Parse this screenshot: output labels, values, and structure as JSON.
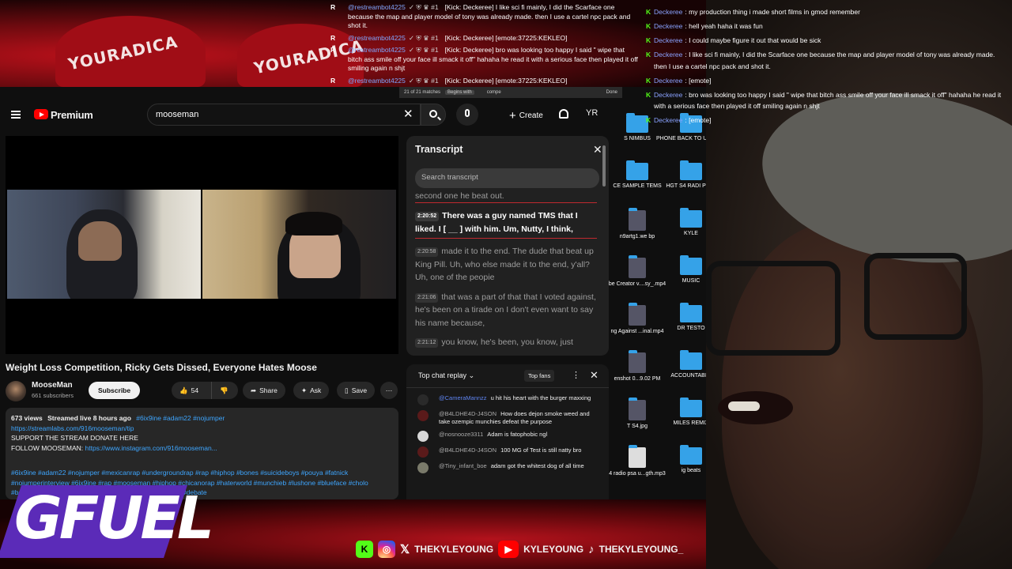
{
  "top_chat": [
    {
      "platform": "R",
      "user": "@restreambot4225",
      "badges": "✓ ⛨ ♛ #1",
      "text": "[Kick: Deckeree] I like sci fi mainly, I did the Scarface one because the map and player model of tony was already made. then I use a cartel npc pack and shot it."
    },
    {
      "platform": "R",
      "user": "@restreambot4225",
      "badges": "✓ ⛨ ♛ #1",
      "text": "[Kick: Deckeree] [emote:37225:KEKLEO]"
    },
    {
      "platform": "R",
      "user": "@restreambot4225",
      "badges": "✓ ⛨ ♛ #1",
      "text": "[Kick: Deckeree] bro was looking too happy I said \" wipe that bitch ass smile off your face ill smack it off\" hahaha he read it with a serious face then played it off smiling again n shjt"
    },
    {
      "platform": "R",
      "user": "@restreambot4225",
      "badges": "✓ ⛨ ♛ #1",
      "text": "[Kick: Deckeree] [emote:37225:KEKLEO]"
    }
  ],
  "find_bar": {
    "count": "21 of 21 matches",
    "mode": "Begins with",
    "query": "compe",
    "done": "Done"
  },
  "header": {
    "brand": "Premium",
    "search_value": "mooseman",
    "create_label": "Create",
    "avatar_initials": "YR"
  },
  "video": {
    "title": "Weight Loss Competition, Ricky Gets Dissed, Everyone Hates Moose",
    "channel": "MooseMan",
    "subscribers": "661 subscribers",
    "subscribe_label": "Subscribe",
    "likes": "54",
    "share_label": "Share",
    "ask_label": "Ask",
    "save_label": "Save"
  },
  "description": {
    "views": "673 views",
    "streamed": "Streamed live 8 hours ago",
    "hashtags_top": "#6ix9ine #adam22 #nojumper",
    "link1": "https://streamlabs.com/916mooseman/tip",
    "line2": "SUPPORT THE STREAM DONATE HERE",
    "follow_prefix": "FOLLOW MOOSEMAN:",
    "link2": "https://www.instagram.com/916mooseman...",
    "tags": "#6ix9ine #adam22 #nojumper #mexicanrap #undergroundrap #rap #hiphop #bones #suicideboys #pouya #fatnick #nojumperinterview #6ix9ine #rap #mooseman #hiphop #chicanorap #haterworld #munchieb #lushone #blueface #cholo #bomberboy #chicanorap #chicano #racedebate #hiphop #debate"
  },
  "transcript": {
    "title": "Transcript",
    "search_placeholder": "Search transcript",
    "partial": "second one he beat out.",
    "segments": [
      {
        "time": "2:20:52",
        "text": "There was a guy named TMS that I liked. I [ __ ] with him. Um, Nutty, I think,",
        "active": true
      },
      {
        "time": "2:20:58",
        "text": "made it to the end. The dude that beat up King Pill. Uh, who else made it to the end, y'all? Uh, one of the peopie",
        "active": false
      },
      {
        "time": "2:21:06",
        "text": "that was a part of that that I voted against, he's been on a tirade on I don't even want to say his name because,",
        "active": false
      },
      {
        "time": "2:21:12",
        "text": "you know, he's been, you know, just",
        "active": false
      }
    ]
  },
  "live_chat": {
    "title": "Top chat replay",
    "top_fans": "Top fans",
    "messages": [
      {
        "user": "@CameraMannzz",
        "mod": true,
        "text": "u hit his heart with the burger maxxing",
        "avatar_color": "#2a2a2a"
      },
      {
        "user": "@B4LDHE4D-J4SON",
        "mod": false,
        "text": "How does dejon smoke weed and take ozempic munchies defeat the purpose",
        "avatar_color": "#5a1a1a"
      },
      {
        "user": "@nosnooze3311",
        "mod": false,
        "text": "Adam is fatophobic ngl",
        "avatar_color": "#d8d8d8"
      },
      {
        "user": "@B4LDHE4D-J4SON",
        "mod": false,
        "text": "100 MG of Test is still natty bro",
        "avatar_color": "#5a1a1a"
      },
      {
        "user": "@Tiny_infant_boe",
        "mod": false,
        "text": "adam got the whitest dog of all time",
        "avatar_color": "#7a7a6a"
      }
    ]
  },
  "desktop_items": [
    {
      "label": "S NIMBUS",
      "type": "folder"
    },
    {
      "label": "PHONE BACK TO UPLOAD",
      "type": "folder"
    },
    {
      "label": "CE SAMPLE TEMS",
      "type": "folder"
    },
    {
      "label": "HGT S4 RADI PSAs",
      "type": "folder"
    },
    {
      "label": "n9artg1.we bp",
      "type": "image"
    },
    {
      "label": "KYLE",
      "type": "folder"
    },
    {
      "label": "be Creator v....sy_.mp4",
      "type": "video"
    },
    {
      "label": "MUSIC",
      "type": "folder"
    },
    {
      "label": "ng Against ...inal.mp4",
      "type": "video"
    },
    {
      "label": "DR TESTO",
      "type": "folder"
    },
    {
      "label": "enshot 0...9.02 PM",
      "type": "image"
    },
    {
      "label": "ACCOUNTABILI",
      "type": "folder"
    },
    {
      "label": "T S4.jpg",
      "type": "image"
    },
    {
      "label": "MILES REMIX",
      "type": "folder"
    },
    {
      "label": "4 radio psa u...gth.mp3",
      "type": "audio"
    },
    {
      "label": "ig beats",
      "type": "folder"
    }
  ],
  "right_chat": [
    {
      "user": "Deckeree",
      "text": "my production thing i made short films in gmod remember"
    },
    {
      "user": "Deckeree",
      "text": "hell yeah haha it was fun"
    },
    {
      "user": "Deckeree",
      "text": "I could maybe figure it out that would be sick"
    },
    {
      "user": "Deckeree",
      "text": "I like sci fi mainly, I did the Scarface one because the map and player model of tony was already made. then I use a cartel npc pack and shot it."
    },
    {
      "user": "Deckeree",
      "text": "[emote]"
    },
    {
      "user": "Deckeree",
      "text": "bro was looking too happy I said \" wipe that bitch ass smile off your face ill smack it off\" hahaha he read it with a serious face then played it off smiling again n shjt"
    },
    {
      "user": "Deckeree",
      "text": "[emote]"
    }
  ],
  "branding": {
    "gfuel": "GFUEL",
    "x_handle": "THEKYLEYOUNG",
    "yt_handle": "KYLEYOUNG",
    "tiktok_handle": "THEKYLEYOUNG_"
  },
  "colors": {
    "kick_green": "#53fc18",
    "youtube_red": "#ff0000",
    "link_blue": "#3ea6ff",
    "gfuel_purple": "#5b2bb8"
  }
}
